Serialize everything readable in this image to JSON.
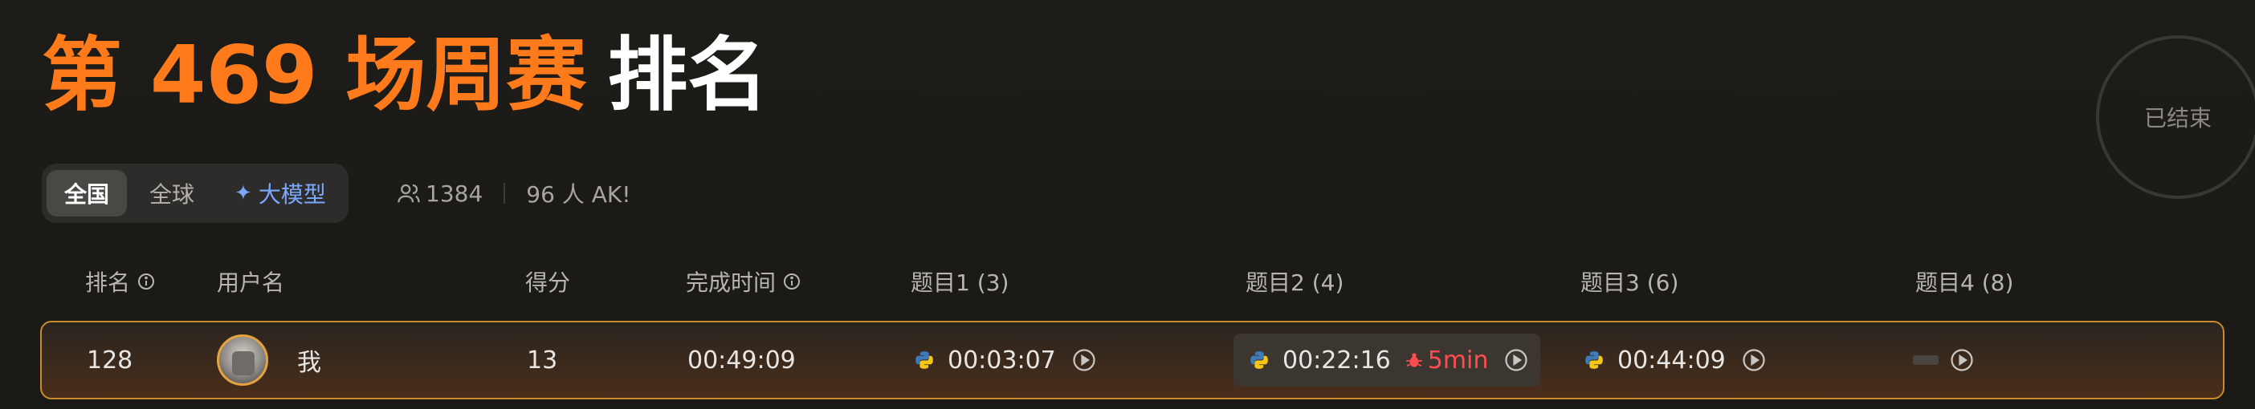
{
  "title": {
    "contest": "第 469 场周赛",
    "rank_word": "排名"
  },
  "status": "已结束",
  "scope_tabs": [
    {
      "label": "全国",
      "active": true
    },
    {
      "label": "全球",
      "active": false
    },
    {
      "label": "大模型",
      "active": false,
      "icon": "sparkle-icon"
    }
  ],
  "stats": {
    "participants": "1384",
    "ak": "96 人 AK!"
  },
  "table": {
    "headers": {
      "rank": "排名",
      "username": "用户名",
      "score": "得分",
      "finish_time": "完成时间",
      "q1": "题目1 (3)",
      "q2": "题目2 (4)",
      "q3": "题目3 (6)",
      "q4": "题目4 (8)"
    },
    "my_row": {
      "rank": "128",
      "username": "我",
      "score": "13",
      "finish_time": "00:49:09",
      "q1_time": "00:03:07",
      "q2_time": "00:22:16",
      "q2_penalty": "5min",
      "q3_time": "00:44:09",
      "language_icon": "python-icon"
    }
  },
  "colors": {
    "accent_orange": "#ff7a1a",
    "highlight_border": "#c88b2c",
    "penalty_red": "#ff4d4f",
    "ai_blue": "#7aa8ff"
  }
}
